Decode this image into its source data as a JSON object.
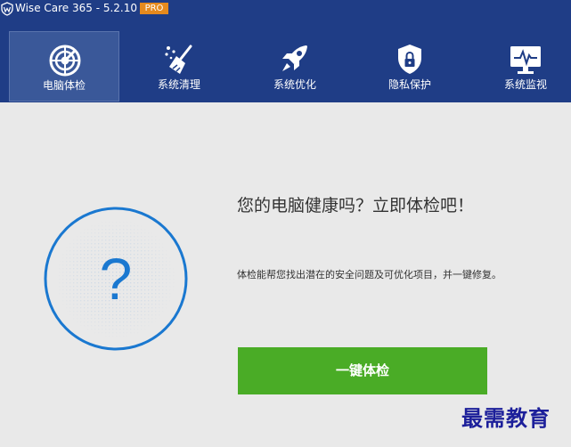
{
  "titlebar": {
    "title": "Wise Care 365 - 5.2.10",
    "badge": "PRO",
    "logo_icon": "shield-w-icon"
  },
  "nav": {
    "tabs": [
      {
        "label": "电脑体检",
        "icon": "radar-icon",
        "active": true
      },
      {
        "label": "系统清理",
        "icon": "broom-icon",
        "active": false
      },
      {
        "label": "系统优化",
        "icon": "rocket-icon",
        "active": false
      },
      {
        "label": "隐私保护",
        "icon": "shield-lock-icon",
        "active": false
      },
      {
        "label": "系统监视",
        "icon": "monitor-pulse-icon",
        "active": false
      }
    ]
  },
  "main": {
    "status_symbol": "?",
    "headline": "您的电脑健康吗？立即体检吧！",
    "description": "体检能帮您找出潜在的安全问题及可优化项目，并一键修复。",
    "scan_button_label": "一键体检"
  },
  "watermark": "最需教育",
  "colors": {
    "header_bg": "#1f3d86",
    "active_tab_bg": "#3a5899",
    "content_bg": "#e9e9e9",
    "circle_stroke": "#1a78d0",
    "button_bg": "#4aac26",
    "badge_bg": "#e58a1e",
    "watermark": "#1c1f9a"
  }
}
